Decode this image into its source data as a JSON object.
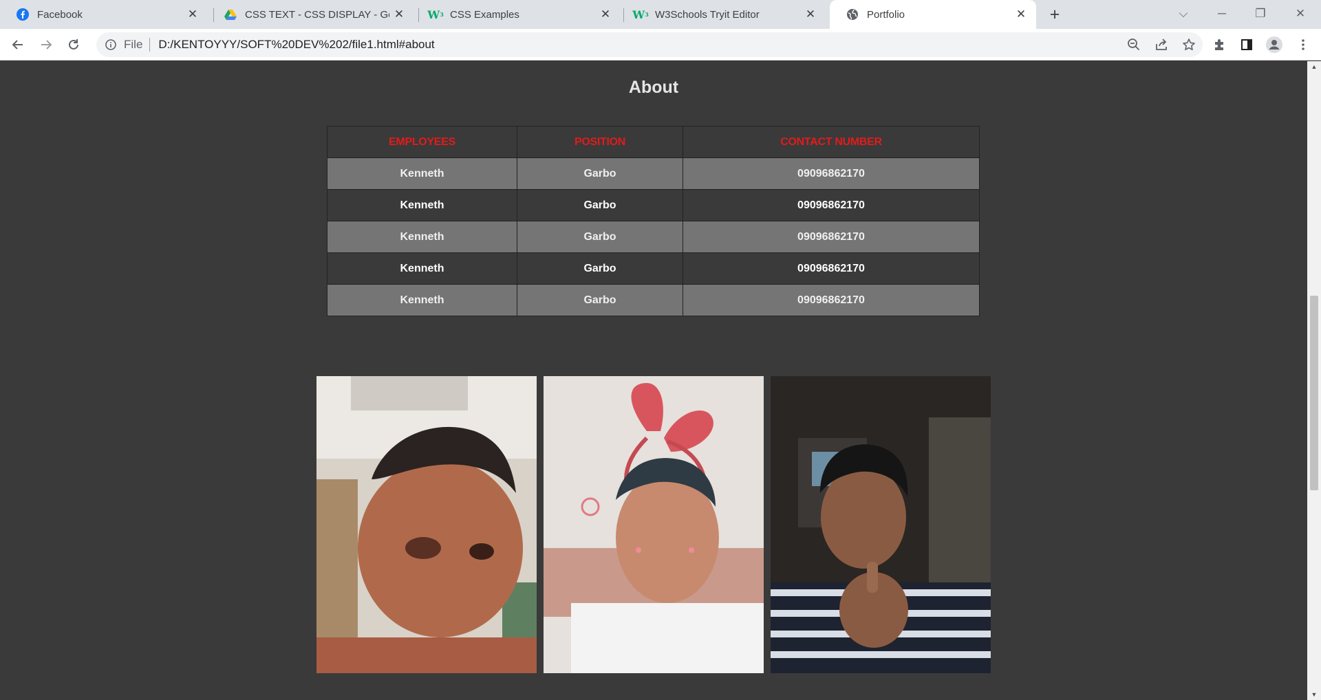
{
  "browser": {
    "tabs": [
      {
        "title": "Facebook",
        "icon": "facebook-icon",
        "active": false
      },
      {
        "title": "CSS TEXT - CSS DISPLAY - Google",
        "icon": "google-drive-icon",
        "active": false
      },
      {
        "title": "CSS Examples",
        "icon": "w3schools-icon",
        "active": false
      },
      {
        "title": "W3Schools Tryit Editor",
        "icon": "w3schools-icon",
        "active": false
      },
      {
        "title": "Portfolio",
        "icon": "globe-icon",
        "active": true
      }
    ],
    "address": {
      "scheme_label": "File",
      "url": "D:/KENTOYYY/SOFT%20DEV%202/file1.html#about"
    }
  },
  "page": {
    "section_title": "About",
    "table": {
      "headers": [
        "EMPLOYEES",
        "POSITION",
        "CONTACT NUMBER"
      ],
      "rows": [
        [
          "Kenneth",
          "Garbo",
          "09096862170"
        ],
        [
          "Kenneth",
          "Garbo",
          "09096862170"
        ],
        [
          "Kenneth",
          "Garbo",
          "09096862170"
        ],
        [
          "Kenneth",
          "Garbo",
          "09096862170"
        ],
        [
          "Kenneth",
          "Garbo",
          "09096862170"
        ]
      ]
    },
    "header_color": "#e21b1b",
    "photos": [
      "selfie-photo-1",
      "selfie-photo-2",
      "selfie-photo-3"
    ]
  }
}
